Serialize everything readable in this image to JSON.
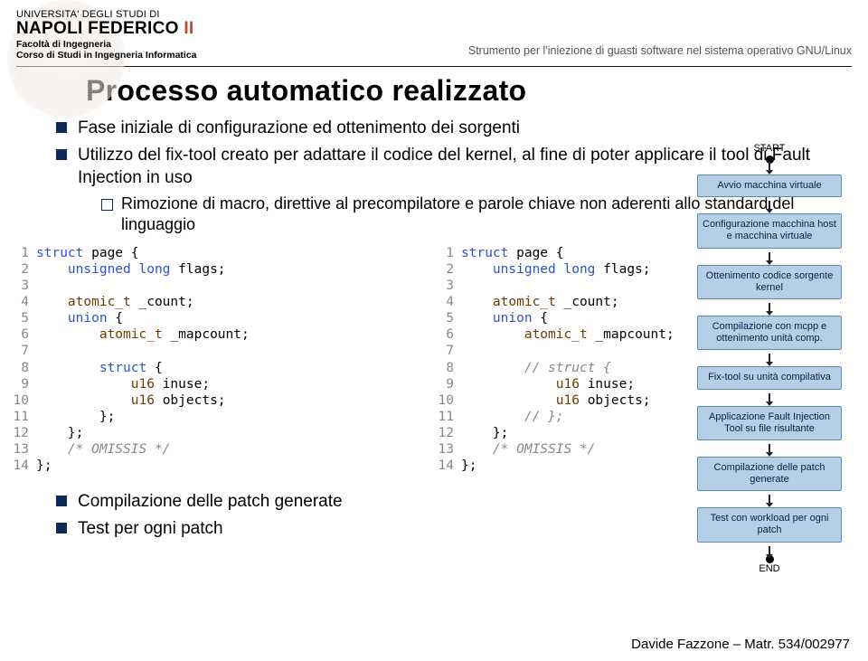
{
  "header": {
    "uni_top": "UNIVERSITA' DEGLI STUDI DI",
    "uni_name_a": "NAPOLI FEDERICO ",
    "uni_name_b": "II",
    "faculty": "Facoltà di Ingegneria",
    "course": "Corso di Studi in Ingegneria Informatica",
    "right": "Strumento per l'iniezione di guasti software nel sistema operativo GNU/Linux"
  },
  "title": "Processo automatico realizzato",
  "bullets": {
    "b1": "Fase iniziale di configurazione ed ottenimento dei sorgenti",
    "b2": "Utilizzo del fix-tool creato per adattare il codice del kernel, al fine di poter applicare il tool di Fault Injection in uso",
    "b2_sub": "Rimozione di macro, direttive al precompilatore e parole chiave non aderenti allo standard del linguaggio"
  },
  "flow": {
    "start": "START",
    "n1": "Avvio macchina virtuale",
    "n2": "Configurazione macchina host e macchina virtuale",
    "n3": "Ottenimento codice sorgente kernel",
    "n4": "Compilazione con mcpp e ottenimento unità comp.",
    "n5": "Fix-tool su unità compilativa",
    "n6": "Applicazione Fault Injection Tool su file risultante",
    "n7": "Compilazione delle patch generate",
    "n8": "Test con workload per ogni patch",
    "end": "END"
  },
  "lower": {
    "l1": "Compilazione delle patch generate",
    "l2": "Test per ogni patch"
  },
  "footer": "Davide Fazzone – Matr. 534/002977"
}
